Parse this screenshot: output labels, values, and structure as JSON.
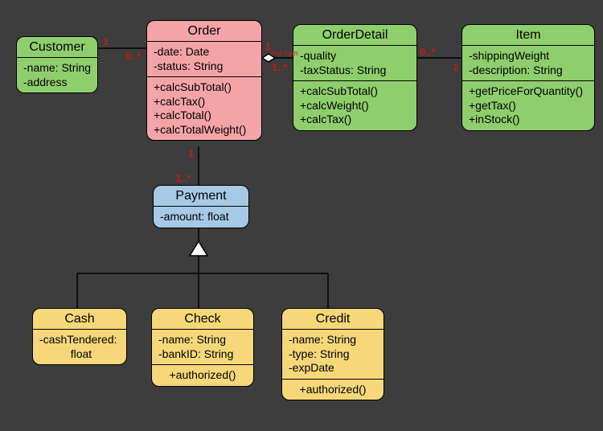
{
  "classes": {
    "customer": {
      "name": "Customer",
      "attrs": [
        "-name: String",
        "-address"
      ]
    },
    "order": {
      "name": "Order",
      "attrs": [
        "-date: Date",
        "-status: String"
      ],
      "ops": [
        "+calcSubTotal()",
        "+calcTax()",
        "+calcTotal()",
        "+calcTotalWeight()"
      ]
    },
    "orderDetail": {
      "name": "OrderDetail",
      "attrs": [
        "-quality",
        "-taxStatus: String"
      ],
      "ops": [
        "+calcSubTotal()",
        "+calcWeight()",
        "+calcTax()"
      ]
    },
    "item": {
      "name": "Item",
      "attrs": [
        "-shippingWeight",
        "-description: String"
      ],
      "ops": [
        "+getPriceForQuantity()",
        "+getTax()",
        "+inStock()"
      ]
    },
    "payment": {
      "name": "Payment",
      "attrs": [
        "-amount: float"
      ]
    },
    "cash": {
      "name": "Cash",
      "attrs": [
        "-cashTendered:",
        " float"
      ]
    },
    "check": {
      "name": "Check",
      "attrs": [
        "-name: String",
        "-bankID: String"
      ],
      "ops": [
        "+authorized()"
      ]
    },
    "credit": {
      "name": "Credit",
      "attrs": [
        "-name: String",
        "-type: String",
        "-expDate"
      ],
      "ops": [
        "+authorized()"
      ]
    }
  },
  "mults": {
    "cust_order_l": "1",
    "cust_order_r": "0..*",
    "order_detail_l": "1",
    "order_detail_r": "1..*",
    "detail_item_l": "0..*",
    "detail_item_r": "1",
    "order_pay_t": "1",
    "order_pay_b": "1..*",
    "order_detail_tag": "line item"
  }
}
